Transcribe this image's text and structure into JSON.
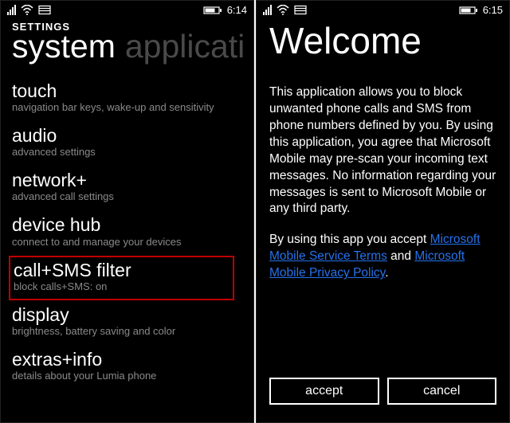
{
  "screen1": {
    "status": {
      "time": "6:14"
    },
    "header": {
      "settings_label": "SETTINGS"
    },
    "pivot": {
      "active": "system",
      "inactive": "applicati"
    },
    "items": [
      {
        "title": "touch",
        "sub": "navigation bar keys, wake-up and sensitivity"
      },
      {
        "title": "audio",
        "sub": "advanced settings"
      },
      {
        "title": "network+",
        "sub": "advanced call settings"
      },
      {
        "title": "device hub",
        "sub": "connect to and manage your devices"
      },
      {
        "title": "call+SMS filter",
        "sub": "block calls+SMS: on"
      },
      {
        "title": "display",
        "sub": "brightness, battery saving and color"
      },
      {
        "title": "extras+info",
        "sub": "details about your Lumia phone"
      }
    ]
  },
  "screen2": {
    "status": {
      "time": "6:15"
    },
    "title": "Welcome",
    "body": "This application allows you to block unwanted phone calls and SMS from phone numbers defined by you. By using this application, you agree that Microsoft Mobile may pre-scan your incoming text messages. No information regarding your messages is sent to Microsoft Mobile or any third party.",
    "accept_prefix": "By using this app you accept ",
    "link1": "Microsoft Mobile Service Terms",
    "joiner": " and ",
    "link2": "Microsoft Mobile Privacy Policy",
    "period": ".",
    "buttons": {
      "accept": "accept",
      "cancel": "cancel"
    }
  }
}
